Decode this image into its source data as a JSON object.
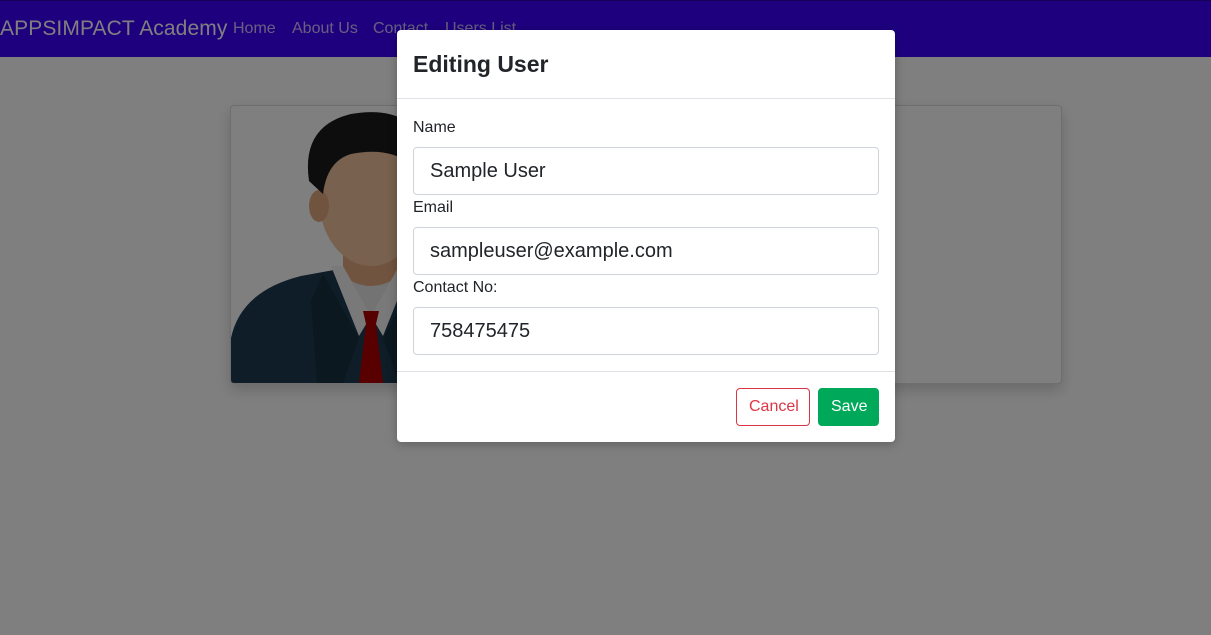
{
  "navbar": {
    "brand": "APPSIMPACT Academy",
    "links": [
      "Home",
      "About Us",
      "Contact",
      "Users List"
    ]
  },
  "modal": {
    "title": "Editing User",
    "fields": {
      "name": {
        "label": "Name",
        "value": "Sample User"
      },
      "email": {
        "label": "Email",
        "value": "sampleuser@example.com"
      },
      "contact": {
        "label": "Contact No:",
        "value": "758475475"
      }
    },
    "buttons": {
      "cancel": "Cancel",
      "save": "Save"
    }
  },
  "colors": {
    "navbar": "#3d00ff",
    "cancel": "#dc3545",
    "save": "#00a85a",
    "tie": "#b00000"
  }
}
